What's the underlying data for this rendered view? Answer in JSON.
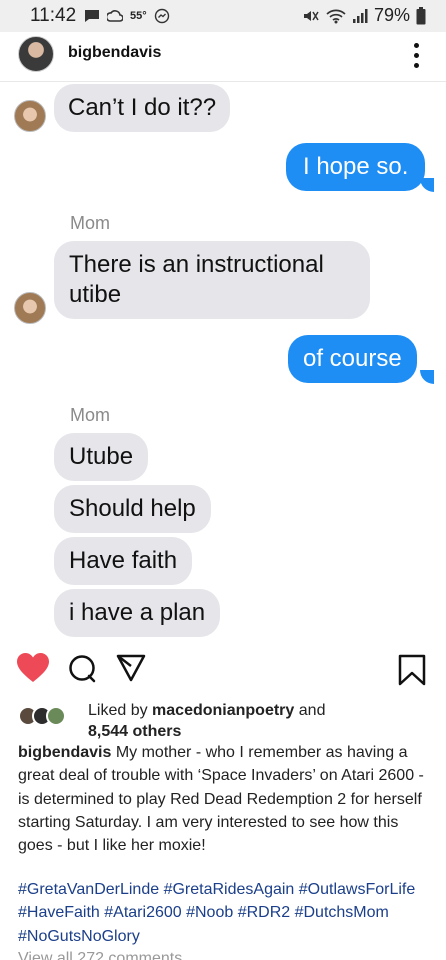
{
  "status_bar": {
    "time": "11:42",
    "temperature": "55°",
    "battery": "79%"
  },
  "header": {
    "username": "bigbendavis"
  },
  "messages": [
    {
      "side": "left",
      "text": "Can’t I do it??"
    },
    {
      "side": "right",
      "text": "I hope so."
    },
    {
      "side": "left",
      "sender": "Mom",
      "text": "There is an instructional utibe"
    },
    {
      "side": "right",
      "text": "of course"
    },
    {
      "side": "left",
      "sender": "Mom",
      "text": "Utube"
    },
    {
      "side": "left",
      "text": "Should help"
    },
    {
      "side": "left",
      "text": "Have faith"
    },
    {
      "side": "left",
      "text": "i have a plan"
    }
  ],
  "post": {
    "liked_prefix": "Liked by",
    "liked_by": "macedonianpoetry",
    "liked_and": "and",
    "likes_count": "8,544 others",
    "caption_user": "bigbendavis",
    "caption_text": "My mother - who I remember as having a great deal of trouble with ‘Space Invaders’ on Atari 2600 - is determined to play Red Dead Redemption 2 for herself starting Saturday. I am very interested to see how this goes - but I like her moxie!",
    "hashtags": "#GretaVanDerLinde #GretaRidesAgain #OutlawsForLife #HaveFaith #Atari2600 #Noob #RDR2 #DutchsMom #NoGutsNoGlory",
    "view_comments": "View all 272 comments"
  },
  "colors": {
    "accent_blue": "#1e8ef5",
    "bubble_gray": "#e5e5ea",
    "like_red": "#ed4956",
    "hashtag": "#1b3f8a"
  }
}
